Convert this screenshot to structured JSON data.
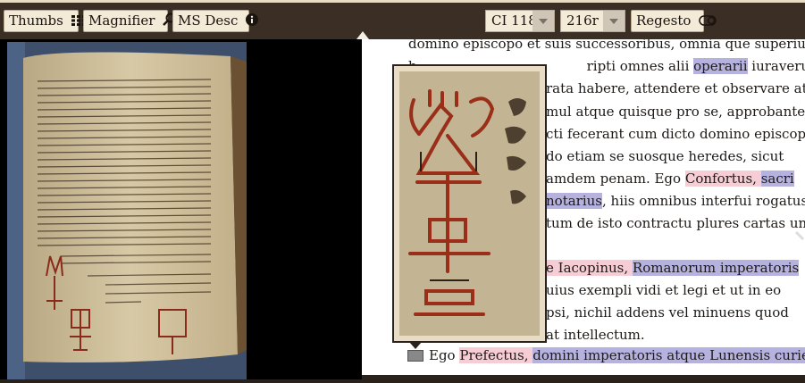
{
  "toolbar": {
    "thumbs_label": "Thumbs",
    "magnifier_label": "Magnifier",
    "msdesc_label": "MS Desc",
    "manuscript_select": "CI 118",
    "folio_select": "216r",
    "regesto_label": "Regesto"
  },
  "text": {
    "line1": "domino episcopo et suis successoribus, omnia que superius",
    "line2a": "b",
    "line2b": "ripti omnes alii ",
    "line2c": "operarii",
    "line2d": " iuraverunt et",
    "line3": "rata habere, attendere et observare atque",
    "line4": "mul atque quisque pro se, approbantes",
    "line5": "cti fecerant cum dicto domino episcopo,",
    "line6": "do etiam se suosque heredes, sicut",
    "line7a": "amdem penam. Ego ",
    "line7b": "Confortus, ",
    "line7c": "sacri",
    "line8a": "notarius",
    "line8b": ", hiis omnibus interfui rogatus et",
    "line9": "tum de isto contractu plures cartas uno",
    "line11a": "e Iacopinus, ",
    "line11b": "Romanorum imperatoris",
    "line12": "uius exempli vidi et legi et ut in eo",
    "line13": "psi, nichil addens vel minuens quod",
    "line14": "at intellectum.",
    "line15a": "Ego ",
    "line15b": "Prefectus, ",
    "line15c": "domini imperatoris atque Lunensis curie"
  }
}
